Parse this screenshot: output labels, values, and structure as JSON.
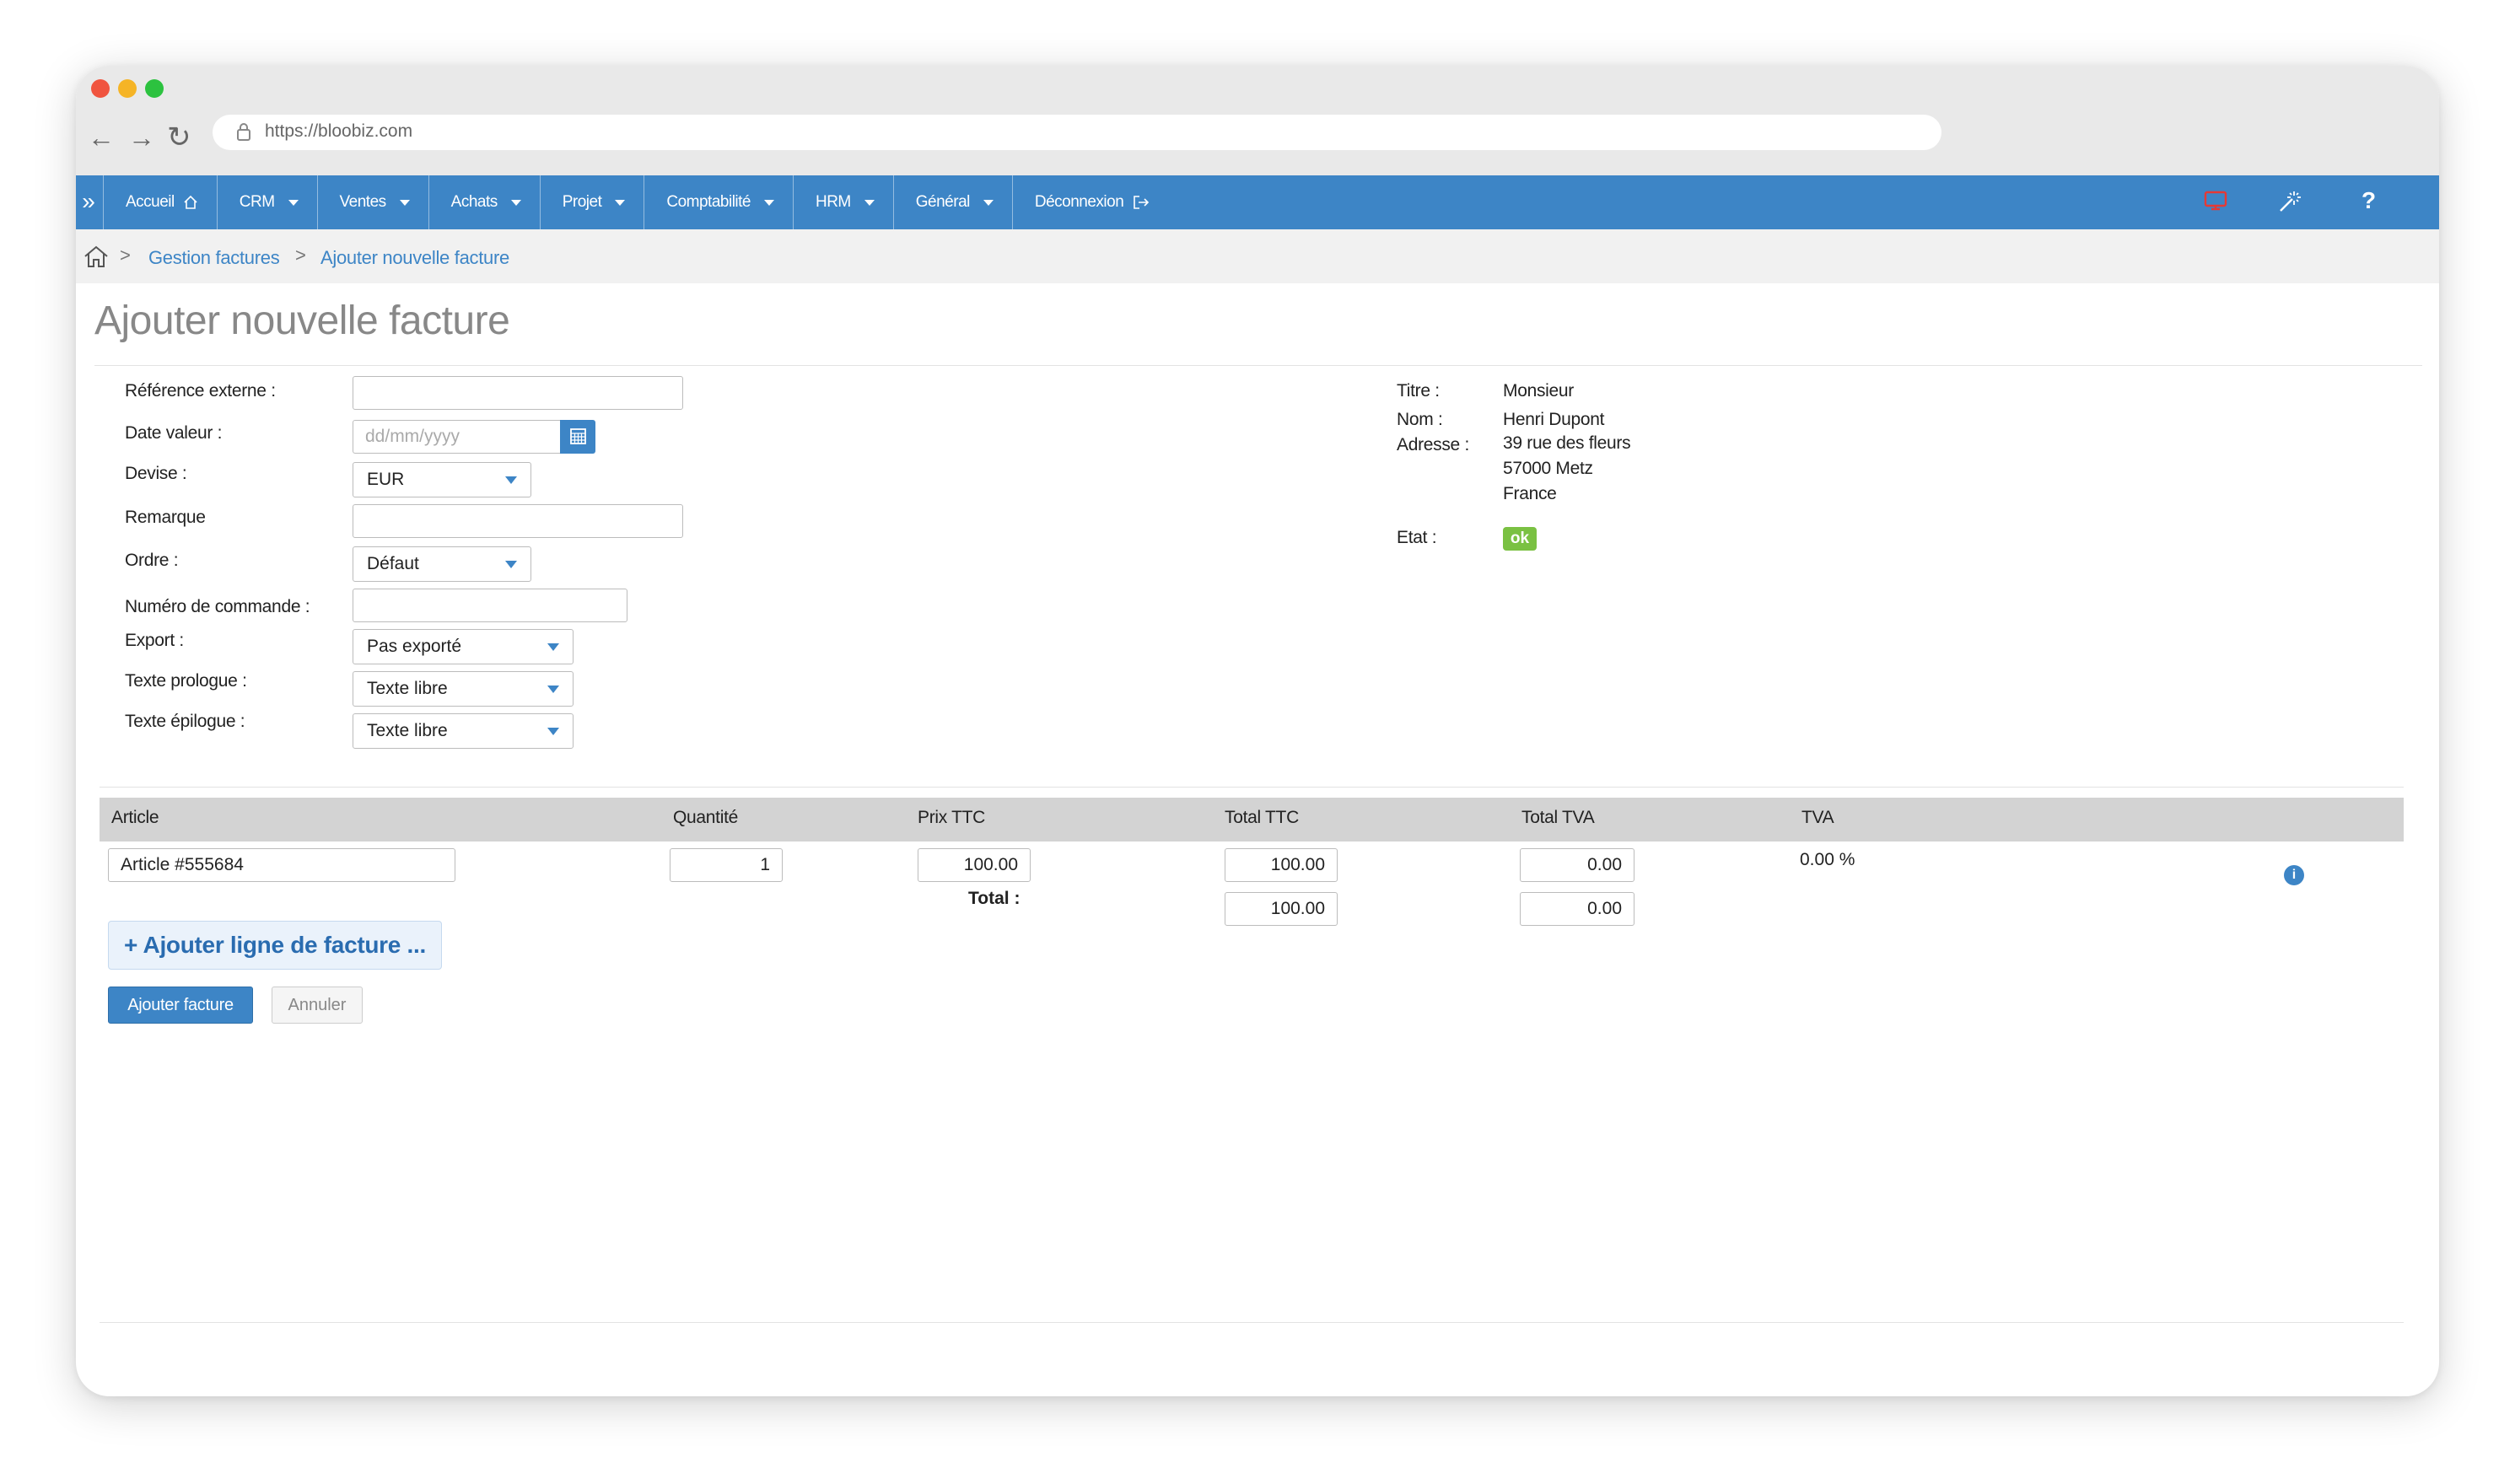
{
  "browser": {
    "url": "https://bloobiz.com",
    "back_icon": "←",
    "forward_icon": "→",
    "reload_icon": "↻"
  },
  "nav": {
    "toggle": "»",
    "items": [
      {
        "label": "Accueil"
      },
      {
        "label": "CRM"
      },
      {
        "label": "Ventes"
      },
      {
        "label": "Achats"
      },
      {
        "label": "Projet"
      },
      {
        "label": "Comptabilité"
      },
      {
        "label": "HRM"
      },
      {
        "label": "Général"
      },
      {
        "label": "Déconnexion"
      }
    ],
    "help": "?"
  },
  "breadcrumb": {
    "items": [
      "Gestion factures",
      "Ajouter nouvelle facture"
    ],
    "separator": ">"
  },
  "page": {
    "title": "Ajouter nouvelle facture"
  },
  "form": {
    "ref_label": "Référence externe :",
    "ref_value": "",
    "date_label": "Date valeur :",
    "date_placeholder": "dd/mm/yyyy",
    "devise_label": "Devise :",
    "devise_value": "EUR",
    "remarque_label": "Remarque",
    "remarque_value": "",
    "ordre_label": "Ordre :",
    "ordre_value": "Défaut",
    "commande_label": "Numéro de commande :",
    "commande_value": "",
    "export_label": "Export :",
    "export_value": "Pas exporté",
    "prologue_label": "Texte prologue :",
    "prologue_value": "Texte libre",
    "epilogue_label": "Texte épilogue :",
    "epilogue_value": "Texte libre"
  },
  "client": {
    "titre_label": "Titre :",
    "titre": "Monsieur",
    "nom_label": "Nom :",
    "nom": "Henri Dupont",
    "adresse_label": "Adresse :",
    "adresse_line1": "39 rue des fleurs",
    "adresse_line2": "57000 Metz",
    "adresse_line3": "France",
    "etat_label": "Etat :",
    "etat": "ok",
    "etat_color": "#7ac142"
  },
  "table": {
    "headers": [
      "Article",
      "Quantité",
      "Prix TTC",
      "Total TTC",
      "Total TVA",
      "TVA"
    ],
    "row": {
      "article": "Article #555684",
      "quantite": "1",
      "prix_ttc": "100.00",
      "total_ttc": "100.00",
      "total_tva": "0.00",
      "tva": "0.00 %",
      "info": "i"
    },
    "total_label": "Total :",
    "total_ttc": "100.00",
    "total_tva": "0.00"
  },
  "actions": {
    "add_line": "+ Ajouter ligne de facture ...",
    "submit": "Ajouter facture",
    "cancel": "Annuler"
  },
  "colors": {
    "primary": "#3d85c6",
    "nav_bg": "#3d85c6",
    "ok_badge": "#7ac142"
  }
}
